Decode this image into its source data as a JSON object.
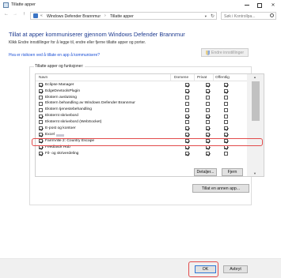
{
  "window": {
    "title": "Tillatte apper"
  },
  "address_bar": {
    "crumbs": [
      "«",
      "Windows Defender Brannmur",
      "›",
      "Tillatte apper"
    ],
    "search_placeholder": "Søk i Kontrollpa..."
  },
  "main": {
    "heading": "Tillat at apper kommuniserer gjennom Windows Defender Brannmur",
    "subtext": "Klikk Endre innstillinger for å legge til, endre eller fjerne tillatte apper og porter.",
    "risk_link": "Hva er risikoen ved å tillate en app å kommunisere?",
    "change_settings_label": "Endre innstillinger"
  },
  "apps_group": {
    "label": "Tillatte apper og funksjoner:",
    "columns": [
      "Navn",
      "Domene",
      "Privat",
      "Offentlig"
    ],
    "rows": [
      {
        "name": "Eclipse Manager",
        "c": [
          true,
          true,
          true,
          true
        ]
      },
      {
        "name": "EdgeDevtoolsPlugin",
        "c": [
          true,
          true,
          true,
          true
        ]
      },
      {
        "name": "Ekstern avslutning",
        "c": [
          false,
          false,
          false,
          false
        ]
      },
      {
        "name": "Ekstern behandling av Windows Defender Brannmur",
        "c": [
          false,
          false,
          false,
          false
        ]
      },
      {
        "name": "Ekstern tjenestebehandling",
        "c": [
          false,
          false,
          false,
          false
        ]
      },
      {
        "name": "Eksternt skrivebord",
        "c": [
          true,
          true,
          true,
          false
        ]
      },
      {
        "name": "Eksternt skrivebord (WebSocket)",
        "c": [
          false,
          false,
          false,
          false
        ]
      },
      {
        "name": "E-post og kontoer",
        "c": [
          true,
          true,
          true,
          true
        ]
      },
      {
        "name": "Excel",
        "c": [
          true,
          true,
          true,
          true
        ]
      },
      {
        "name": "FarmVille 2: Country Escape",
        "c": [
          true,
          true,
          true,
          true
        ]
      },
      {
        "name": "Feedback Hub",
        "c": [
          true,
          true,
          true,
          true
        ]
      },
      {
        "name": "Fil- og skriverdeling",
        "c": [
          true,
          true,
          true,
          false
        ]
      }
    ],
    "details_label": "Detaljer...",
    "remove_label": "Fjern"
  },
  "allow_other_label": "Tillat en annen app...",
  "footer": {
    "ok_label": "OK",
    "cancel_label": "Avbryt"
  },
  "colors": {
    "heading": "#1d3a8f",
    "link": "#1a4fd6",
    "highlight": "#e24b4b"
  }
}
